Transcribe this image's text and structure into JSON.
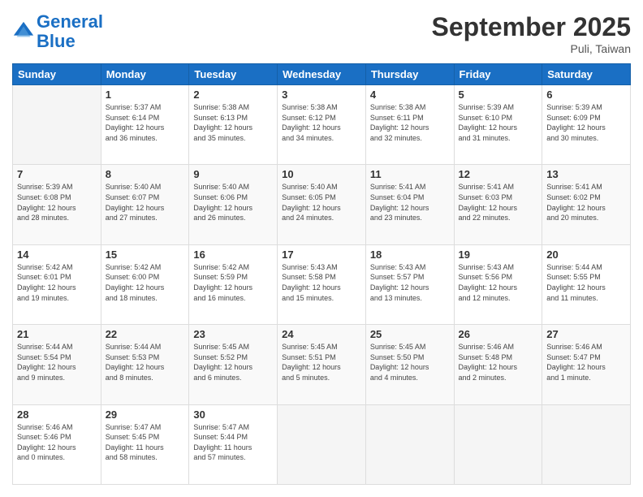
{
  "header": {
    "logo_line1": "General",
    "logo_line2": "Blue",
    "title": "September 2025",
    "location": "Puli, Taiwan"
  },
  "days_of_week": [
    "Sunday",
    "Monday",
    "Tuesday",
    "Wednesday",
    "Thursday",
    "Friday",
    "Saturday"
  ],
  "weeks": [
    [
      {
        "day": "",
        "info": ""
      },
      {
        "day": "1",
        "info": "Sunrise: 5:37 AM\nSunset: 6:14 PM\nDaylight: 12 hours\nand 36 minutes."
      },
      {
        "day": "2",
        "info": "Sunrise: 5:38 AM\nSunset: 6:13 PM\nDaylight: 12 hours\nand 35 minutes."
      },
      {
        "day": "3",
        "info": "Sunrise: 5:38 AM\nSunset: 6:12 PM\nDaylight: 12 hours\nand 34 minutes."
      },
      {
        "day": "4",
        "info": "Sunrise: 5:38 AM\nSunset: 6:11 PM\nDaylight: 12 hours\nand 32 minutes."
      },
      {
        "day": "5",
        "info": "Sunrise: 5:39 AM\nSunset: 6:10 PM\nDaylight: 12 hours\nand 31 minutes."
      },
      {
        "day": "6",
        "info": "Sunrise: 5:39 AM\nSunset: 6:09 PM\nDaylight: 12 hours\nand 30 minutes."
      }
    ],
    [
      {
        "day": "7",
        "info": "Sunrise: 5:39 AM\nSunset: 6:08 PM\nDaylight: 12 hours\nand 28 minutes."
      },
      {
        "day": "8",
        "info": "Sunrise: 5:40 AM\nSunset: 6:07 PM\nDaylight: 12 hours\nand 27 minutes."
      },
      {
        "day": "9",
        "info": "Sunrise: 5:40 AM\nSunset: 6:06 PM\nDaylight: 12 hours\nand 26 minutes."
      },
      {
        "day": "10",
        "info": "Sunrise: 5:40 AM\nSunset: 6:05 PM\nDaylight: 12 hours\nand 24 minutes."
      },
      {
        "day": "11",
        "info": "Sunrise: 5:41 AM\nSunset: 6:04 PM\nDaylight: 12 hours\nand 23 minutes."
      },
      {
        "day": "12",
        "info": "Sunrise: 5:41 AM\nSunset: 6:03 PM\nDaylight: 12 hours\nand 22 minutes."
      },
      {
        "day": "13",
        "info": "Sunrise: 5:41 AM\nSunset: 6:02 PM\nDaylight: 12 hours\nand 20 minutes."
      }
    ],
    [
      {
        "day": "14",
        "info": "Sunrise: 5:42 AM\nSunset: 6:01 PM\nDaylight: 12 hours\nand 19 minutes."
      },
      {
        "day": "15",
        "info": "Sunrise: 5:42 AM\nSunset: 6:00 PM\nDaylight: 12 hours\nand 18 minutes."
      },
      {
        "day": "16",
        "info": "Sunrise: 5:42 AM\nSunset: 5:59 PM\nDaylight: 12 hours\nand 16 minutes."
      },
      {
        "day": "17",
        "info": "Sunrise: 5:43 AM\nSunset: 5:58 PM\nDaylight: 12 hours\nand 15 minutes."
      },
      {
        "day": "18",
        "info": "Sunrise: 5:43 AM\nSunset: 5:57 PM\nDaylight: 12 hours\nand 13 minutes."
      },
      {
        "day": "19",
        "info": "Sunrise: 5:43 AM\nSunset: 5:56 PM\nDaylight: 12 hours\nand 12 minutes."
      },
      {
        "day": "20",
        "info": "Sunrise: 5:44 AM\nSunset: 5:55 PM\nDaylight: 12 hours\nand 11 minutes."
      }
    ],
    [
      {
        "day": "21",
        "info": "Sunrise: 5:44 AM\nSunset: 5:54 PM\nDaylight: 12 hours\nand 9 minutes."
      },
      {
        "day": "22",
        "info": "Sunrise: 5:44 AM\nSunset: 5:53 PM\nDaylight: 12 hours\nand 8 minutes."
      },
      {
        "day": "23",
        "info": "Sunrise: 5:45 AM\nSunset: 5:52 PM\nDaylight: 12 hours\nand 6 minutes."
      },
      {
        "day": "24",
        "info": "Sunrise: 5:45 AM\nSunset: 5:51 PM\nDaylight: 12 hours\nand 5 minutes."
      },
      {
        "day": "25",
        "info": "Sunrise: 5:45 AM\nSunset: 5:50 PM\nDaylight: 12 hours\nand 4 minutes."
      },
      {
        "day": "26",
        "info": "Sunrise: 5:46 AM\nSunset: 5:48 PM\nDaylight: 12 hours\nand 2 minutes."
      },
      {
        "day": "27",
        "info": "Sunrise: 5:46 AM\nSunset: 5:47 PM\nDaylight: 12 hours\nand 1 minute."
      }
    ],
    [
      {
        "day": "28",
        "info": "Sunrise: 5:46 AM\nSunset: 5:46 PM\nDaylight: 12 hours\nand 0 minutes."
      },
      {
        "day": "29",
        "info": "Sunrise: 5:47 AM\nSunset: 5:45 PM\nDaylight: 11 hours\nand 58 minutes."
      },
      {
        "day": "30",
        "info": "Sunrise: 5:47 AM\nSunset: 5:44 PM\nDaylight: 11 hours\nand 57 minutes."
      },
      {
        "day": "",
        "info": ""
      },
      {
        "day": "",
        "info": ""
      },
      {
        "day": "",
        "info": ""
      },
      {
        "day": "",
        "info": ""
      }
    ]
  ]
}
